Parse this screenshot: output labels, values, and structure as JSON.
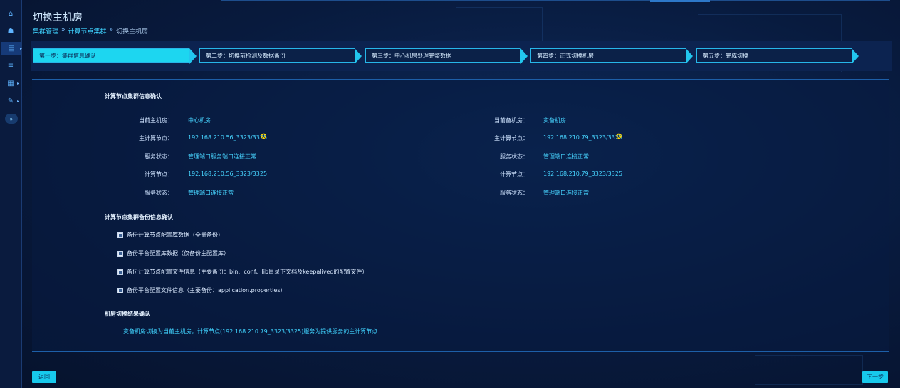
{
  "sidebar": {
    "items": [
      {
        "icon": "home-icon",
        "glyph": "⌂"
      },
      {
        "icon": "user-group-icon",
        "glyph": "☗"
      },
      {
        "icon": "server-icon",
        "glyph": "▤",
        "arrow": "▸"
      },
      {
        "icon": "database-icon",
        "glyph": "≡"
      },
      {
        "icon": "document-icon",
        "glyph": "▦",
        "arrow": "▸"
      },
      {
        "icon": "wrench-icon",
        "glyph": "✎",
        "arrow": "▸"
      },
      {
        "icon": "expand-icon",
        "glyph": "»"
      }
    ]
  },
  "header": {
    "title": "切换主机房",
    "breadcrumb": [
      "集群管理",
      "计算节点集群",
      "切换主机房"
    ],
    "separator": "»"
  },
  "steps": [
    {
      "label": "第一步：集群信息确认",
      "active": true
    },
    {
      "label": "第二步：切换前检测及数据备份",
      "active": false
    },
    {
      "label": "第三步：中心机房处理完整数据",
      "active": false
    },
    {
      "label": "第四步：正式切换机房",
      "active": false
    },
    {
      "label": "第五步：完成切换",
      "active": false
    }
  ],
  "cluster_info": {
    "title": "计算节点集群信息确认",
    "left": {
      "room_label": "当前主机房：",
      "room_value": "中心机房",
      "master_label": "主计算节点：",
      "master_value": "192.168.210.56_3323/3325",
      "status1_label": "服务状态：",
      "status1_value": "管理端口服务端口连接正常",
      "node_label": "计算节点：",
      "node_value": "192.168.210.56_3323/3325",
      "status2_label": "服务状态：",
      "status2_value": "管理端口连接正常"
    },
    "right": {
      "room_label": "当前备机房：",
      "room_value": "灾备机房",
      "master_label": "主计算节点：",
      "master_value": "192.168.210.79_3323/3325",
      "status1_label": "服务状态：",
      "status1_value": "管理端口连接正常",
      "node_label": "计算节点：",
      "node_value": "192.168.210.79_3323/3325",
      "status2_label": "服务状态：",
      "status2_value": "管理端口连接正常"
    }
  },
  "backup_info": {
    "title": "计算节点集群备份信息确认",
    "items": [
      "备份计算节点配置库数据（全量备份）",
      "备份平台配置库数据（仅备份主配置库）",
      "备份计算节点配置文件信息（主要备份：bin、conf、lib目录下文档及keepalived的配置文件）",
      "备份平台配置文件信息（主要备份：application.properties）"
    ]
  },
  "switch_confirm": {
    "title": "机房切换结果确认",
    "text": "灾备机房切换为当前主机房，计算节点(192.168.210.79_3323/3325)服务为提供服务的主计算节点"
  },
  "footer": {
    "back_label": "返回",
    "next_label": "下一步"
  },
  "colors": {
    "accent": "#1dd6f0",
    "link": "#47d4ff",
    "warning_icon": "#ffd400"
  }
}
